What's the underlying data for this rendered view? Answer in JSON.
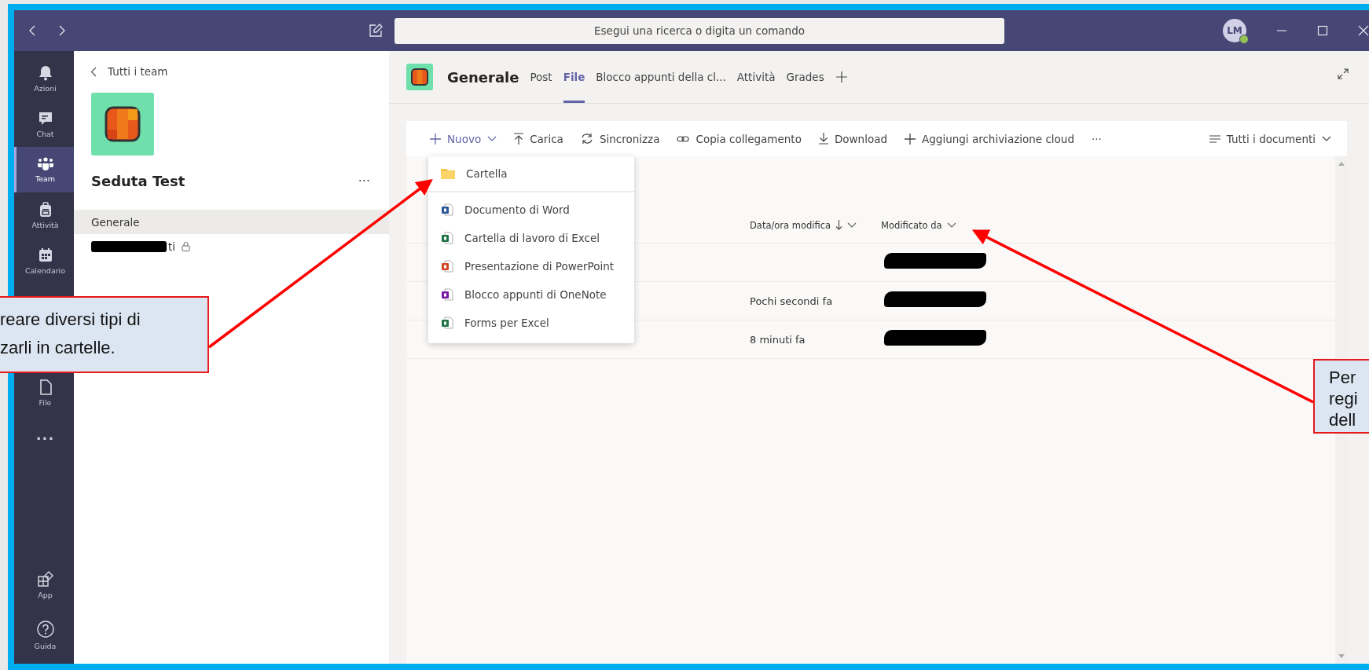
{
  "window": {
    "search_placeholder": "Esegui una ricerca o digita un comando",
    "avatar_initials": "LM"
  },
  "app_bar": [
    {
      "label": "Azioni",
      "kind": "bell",
      "selected": false
    },
    {
      "label": "Chat",
      "kind": "chat",
      "selected": false
    },
    {
      "label": "Team",
      "kind": "team",
      "selected": true
    },
    {
      "label": "Attività",
      "kind": "bag",
      "selected": false
    },
    {
      "label": "Calendario",
      "kind": "calendar",
      "selected": false
    },
    {
      "label": "File",
      "kind": "file",
      "selected": false
    },
    {
      "label": "···",
      "kind": "more",
      "selected": false
    }
  ],
  "app_bar_bottom": [
    {
      "label": "App",
      "kind": "apps",
      "selected": false
    },
    {
      "label": "Guida",
      "kind": "help",
      "selected": false
    }
  ],
  "team_panel": {
    "back_link": "Tutti i team",
    "team_name": "Seduta Test",
    "more": "···",
    "channels": [
      {
        "name": "Generale",
        "selected": true,
        "redacted": false,
        "private": false
      },
      {
        "name": "ti",
        "selected": false,
        "redacted": true,
        "private": true
      }
    ]
  },
  "channel_header": {
    "title": "Generale",
    "tabs": [
      {
        "label": "Post",
        "selected": false
      },
      {
        "label": "File",
        "selected": true
      },
      {
        "label": "Blocco appunti della cl...",
        "selected": false
      },
      {
        "label": "Attività",
        "selected": false
      },
      {
        "label": "Grades",
        "selected": false
      }
    ]
  },
  "toolbar": [
    {
      "label": "Nuovo",
      "kind": "plus",
      "primary": true,
      "dropdown": true
    },
    {
      "label": "Carica",
      "kind": "upload",
      "primary": false,
      "dropdown": false
    },
    {
      "label": "Sincronizza",
      "kind": "sync",
      "primary": false,
      "dropdown": false
    },
    {
      "label": "Copia collegamento",
      "kind": "link",
      "primary": false,
      "dropdown": false
    },
    {
      "label": "Download",
      "kind": "download",
      "primary": false,
      "dropdown": false
    },
    {
      "label": "Aggiungi archiviazione cloud",
      "kind": "plus",
      "primary": false,
      "dropdown": false
    }
  ],
  "toolbar_more": "···",
  "view_selector": {
    "label": "Tutti i documenti"
  },
  "table": {
    "columns": [
      {
        "label": "Data/ora modifica",
        "sorted": true
      },
      {
        "label": "Modificato da",
        "sorted": false
      }
    ],
    "rows": [
      {
        "author_redacted": true
      },
      {
        "modified": "Pochi secondi fa",
        "author_redacted": true
      },
      {
        "modified": "8 minuti fa",
        "author_redacted": true
      }
    ]
  },
  "new_menu": {
    "items": [
      {
        "label": "Cartella",
        "kind": "folder"
      },
      {
        "label": "Documento di Word",
        "kind": "word"
      },
      {
        "label": "Cartella di lavoro di Excel",
        "kind": "excel"
      },
      {
        "label": "Presentazione di PowerPoint",
        "kind": "powerpoint"
      },
      {
        "label": "Blocco appunti di OneNote",
        "kind": "onenote"
      },
      {
        "label": "Forms per Excel",
        "kind": "excel"
      }
    ]
  },
  "callouts": [
    {
      "lines": [
        "reare diversi tipi di",
        "zarli in cartelle."
      ]
    },
    {
      "lines": [
        "Per",
        "regi",
        "dell"
      ]
    }
  ]
}
